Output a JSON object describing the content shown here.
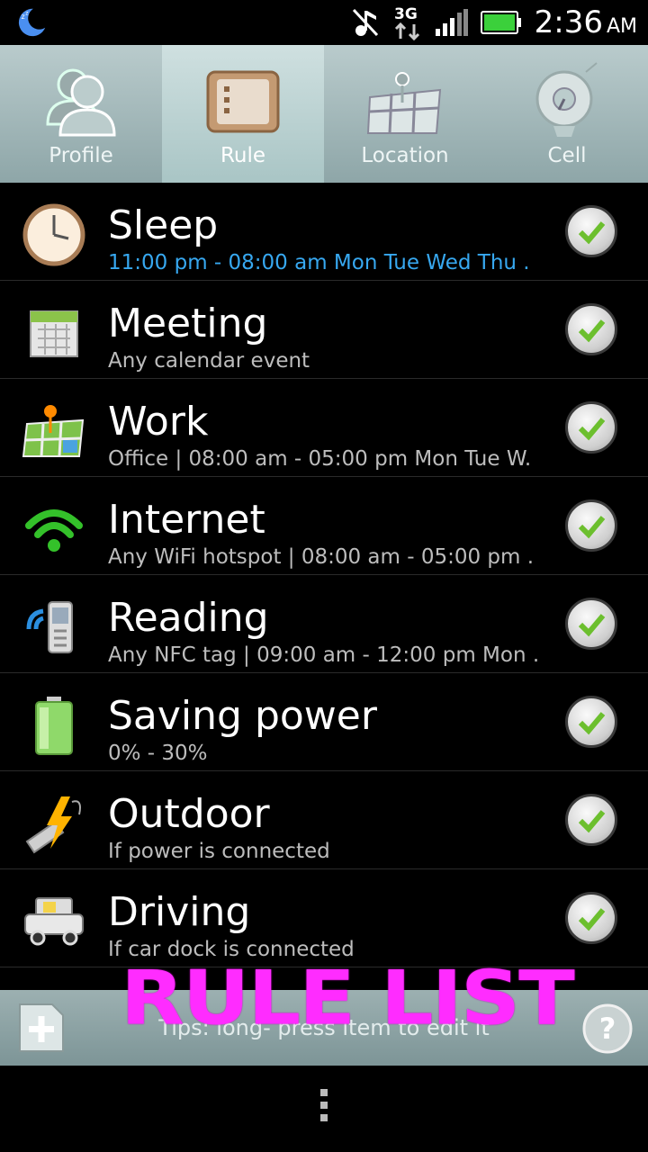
{
  "status_bar": {
    "time": "2:36",
    "ampm": "AM",
    "network": "3G",
    "icons": [
      "moon-icon",
      "mute-icon",
      "3g-icon",
      "signal-icon",
      "battery-icon"
    ]
  },
  "tabs": [
    {
      "label": "Profile",
      "icon": "profile-icon",
      "active": false
    },
    {
      "label": "Rule",
      "icon": "rule-icon",
      "active": true
    },
    {
      "label": "Location",
      "icon": "map-icon",
      "active": false
    },
    {
      "label": "Cell",
      "icon": "cell-icon",
      "active": false
    }
  ],
  "rules": [
    {
      "title": "Sleep",
      "subtitle": "11:00 pm - 08:00 am  Mon Tue Wed Thu .",
      "icon": "clock-icon",
      "enabled": true
    },
    {
      "title": "Meeting",
      "subtitle": "Any calendar event",
      "icon": "calendar-icon",
      "enabled": true
    },
    {
      "title": "Work",
      "subtitle": "Office | 08:00 am - 05:00 pm Mon Tue W.",
      "icon": "map-pin-icon",
      "enabled": true
    },
    {
      "title": "Internet",
      "subtitle": "Any WiFi hotspot | 08:00 am - 05:00 pm .",
      "icon": "wifi-icon",
      "enabled": true
    },
    {
      "title": "Reading",
      "subtitle": "Any NFC tag | 09:00 am - 12:00 pm Mon .",
      "icon": "nfc-icon",
      "enabled": true
    },
    {
      "title": "Saving power",
      "subtitle": "0% - 30%",
      "icon": "battery-icon",
      "enabled": true
    },
    {
      "title": "Outdoor",
      "subtitle": "If power is connected",
      "icon": "power-plug-icon",
      "enabled": true
    },
    {
      "title": "Driving",
      "subtitle": "If car dock is connected",
      "icon": "car-icon",
      "enabled": true
    }
  ],
  "bottom_bar": {
    "tips": "Tips: long- press item to edit it",
    "overlay": "RULE LIST"
  },
  "colors": {
    "accent_blue": "#37a8f0",
    "overlay_magenta": "#ff2cff",
    "tab_bg": "#8ea6a8"
  }
}
